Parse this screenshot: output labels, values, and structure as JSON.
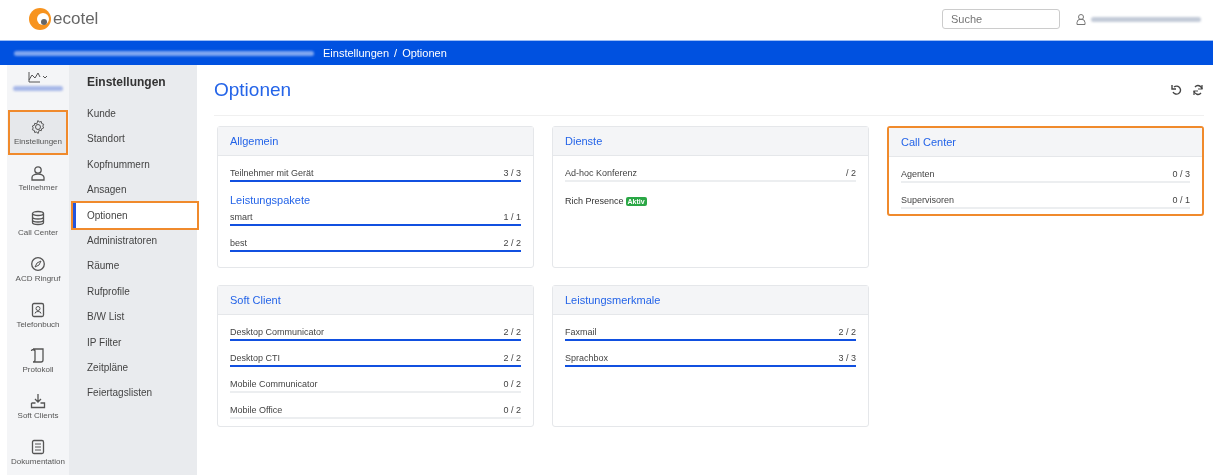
{
  "header": {
    "logo": "ecotel",
    "search": {
      "placeholder": "Suche"
    }
  },
  "breadcrumb": {
    "items": [
      "Einstellungen",
      "Optionen"
    ],
    "separator": "/"
  },
  "rail": {
    "items": [
      {
        "label": "Einstellungen",
        "selected": true,
        "highlighted": true
      },
      {
        "label": "Teilnehmer",
        "selected": false,
        "highlighted": false
      },
      {
        "label": "Call Center",
        "selected": false,
        "highlighted": false
      },
      {
        "label": "ACD Ringruf",
        "selected": false,
        "highlighted": false
      },
      {
        "label": "Telefonbuch",
        "selected": false,
        "highlighted": false
      },
      {
        "label": "Protokoll",
        "selected": false,
        "highlighted": false
      },
      {
        "label": "Soft Clients",
        "selected": false,
        "highlighted": false
      },
      {
        "label": "Dokumentation",
        "selected": false,
        "highlighted": false
      }
    ]
  },
  "submenu": {
    "title": "Einstellungen",
    "items": [
      {
        "label": "Kunde",
        "selected": false,
        "highlighted": false
      },
      {
        "label": "Standort",
        "selected": false,
        "highlighted": false
      },
      {
        "label": "Kopfnummern",
        "selected": false,
        "highlighted": false
      },
      {
        "label": "Ansagen",
        "selected": false,
        "highlighted": false
      },
      {
        "label": "Optionen",
        "selected": true,
        "highlighted": true
      },
      {
        "label": "Administratoren",
        "selected": false,
        "highlighted": false
      },
      {
        "label": "Räume",
        "selected": false,
        "highlighted": false
      },
      {
        "label": "Rufprofile",
        "selected": false,
        "highlighted": false
      },
      {
        "label": "B/W List",
        "selected": false,
        "highlighted": false
      },
      {
        "label": "IP Filter",
        "selected": false,
        "highlighted": false
      },
      {
        "label": "Zeitpläne",
        "selected": false,
        "highlighted": false
      },
      {
        "label": "Feiertagslisten",
        "selected": false,
        "highlighted": false
      }
    ]
  },
  "page": {
    "title": "Optionen"
  },
  "cards": [
    {
      "title": "Allgemein",
      "highlighted": false,
      "rows": [
        {
          "kind": "meter",
          "label": "Teilnehmer mit Gerät",
          "value": "3 / 3",
          "level": 1
        },
        {
          "kind": "heading",
          "label": "Leistungspakete"
        },
        {
          "kind": "meter",
          "label": "smart",
          "value": "1 / 1",
          "level": 1
        },
        {
          "kind": "meter",
          "label": "best",
          "value": "2 / 2",
          "level": 1
        }
      ]
    },
    {
      "title": "Dienste",
      "highlighted": false,
      "rows": [
        {
          "kind": "meter",
          "label": "Ad-hoc Konferenz",
          "value": "/ 2",
          "level": 0
        },
        {
          "kind": "badge",
          "label": "Rich Presence",
          "badge": "Aktiv"
        }
      ]
    },
    {
      "title": "Call Center",
      "highlighted": true,
      "rows": [
        {
          "kind": "meter",
          "label": "Agenten",
          "value": "0 / 3",
          "level": 0
        },
        {
          "kind": "meter",
          "label": "Supervisoren",
          "value": "0 / 1",
          "level": 0
        }
      ]
    },
    {
      "title": "Soft Client",
      "highlighted": false,
      "rows": [
        {
          "kind": "meter",
          "label": "Desktop Communicator",
          "value": "2 / 2",
          "level": 1
        },
        {
          "kind": "meter",
          "label": "Desktop CTI",
          "value": "2 / 2",
          "level": 1
        },
        {
          "kind": "meter",
          "label": "Mobile Communicator",
          "value": "0 / 2",
          "level": 0
        },
        {
          "kind": "meter",
          "label": "Mobile Office",
          "value": "0 / 2",
          "level": 0
        }
      ]
    },
    {
      "title": "Leistungsmerkmale",
      "highlighted": false,
      "rows": [
        {
          "kind": "meter",
          "label": "Faxmail",
          "value": "2 / 2",
          "level": 1
        },
        {
          "kind": "meter",
          "label": "Sprachbox",
          "value": "3 / 3",
          "level": 1
        }
      ]
    }
  ]
}
